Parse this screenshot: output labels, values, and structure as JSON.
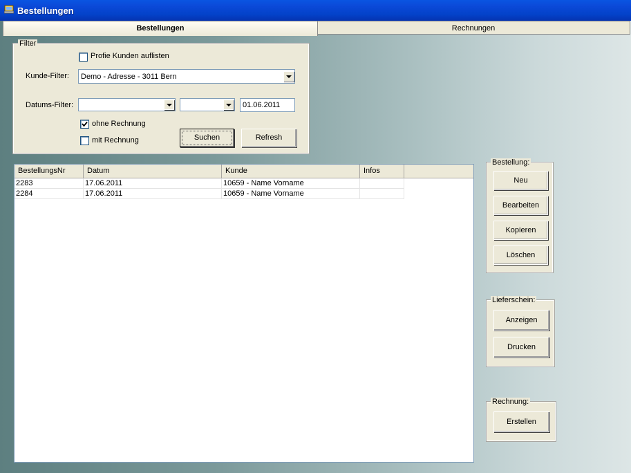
{
  "window": {
    "title": "Bestellungen"
  },
  "tabs": [
    {
      "label": "Bestellungen",
      "active": true
    },
    {
      "label": "Rechnungen",
      "active": false
    }
  ],
  "filter": {
    "group_label": "Filter",
    "profi_checkbox": {
      "label": "Profie Kunden auflisten",
      "checked": false
    },
    "kunde_label": "Kunde-Filter:",
    "kunde_value": "Demo - Adresse - 3011 Bern",
    "datums_label": "Datums-Filter:",
    "datum_combo1": "",
    "datum_combo2": "",
    "datum_text": "01.06.2011",
    "ohne_rechnung": {
      "label": "ohne Rechnung",
      "checked": true
    },
    "mit_rechnung": {
      "label": "mit Rechnung",
      "checked": false
    },
    "search_button": "Suchen",
    "refresh_button": "Refresh"
  },
  "orders_table": {
    "columns": [
      "BestellungsNr",
      "Datum",
      "Kunde",
      "Infos"
    ],
    "rows": [
      [
        "2283",
        "17.06.2011",
        "10659 - Name Vorname",
        ""
      ],
      [
        "2284",
        "17.06.2011",
        "10659 - Name Vorname",
        ""
      ]
    ]
  },
  "bestellung_group": {
    "label": "Bestellung:",
    "buttons": [
      "Neu",
      "Bearbeiten",
      "Kopieren",
      "Löschen"
    ]
  },
  "lieferschein_group": {
    "label": "Lieferschein:",
    "buttons": [
      "Anzeigen",
      "Drucken"
    ]
  },
  "rechnung_group": {
    "label": "Rechnung:",
    "buttons": [
      "Erstellen"
    ]
  },
  "colors": {
    "titlebar": "#0a55e2",
    "panel": "#ece9d8",
    "checkmark": "#000000"
  }
}
